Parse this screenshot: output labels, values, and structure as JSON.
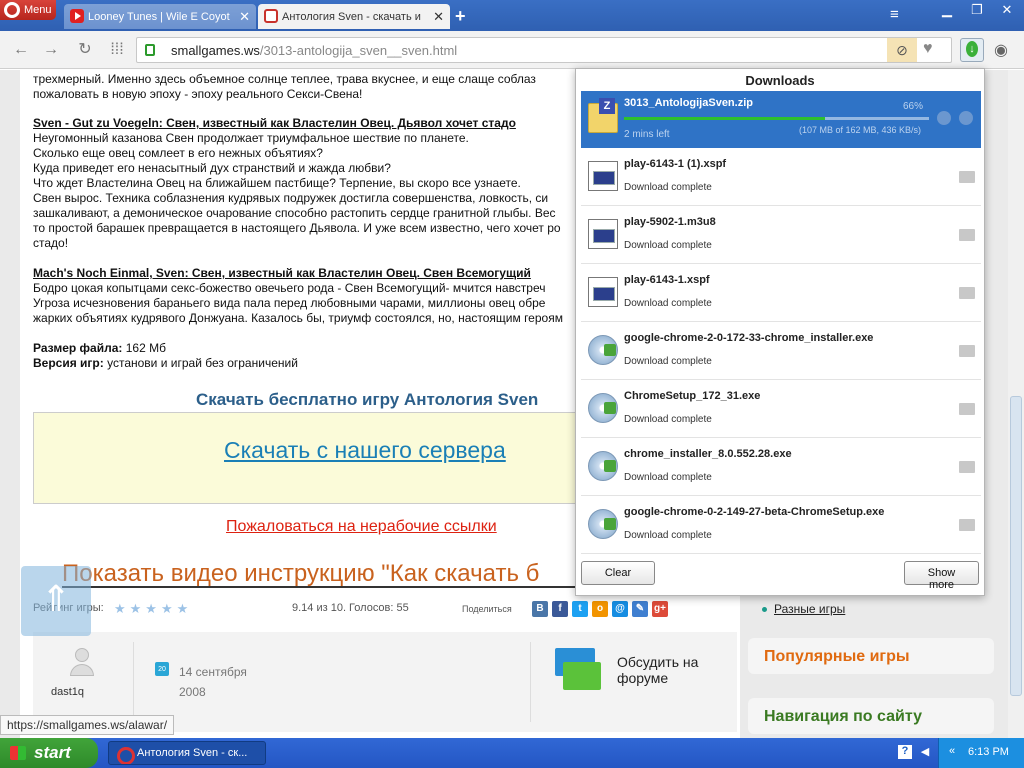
{
  "browser": {
    "menu_label": "Menu",
    "tabs": [
      {
        "title": "Looney Tunes | Wile E Coyot",
        "active": false
      },
      {
        "title": "Антология Sven - скачать и",
        "active": true
      }
    ],
    "address": {
      "host": "smallgames.ws",
      "path": "/3013-antologija_sven__sven.html"
    },
    "status_url": "https://smallgames.ws/alawar/"
  },
  "article": {
    "intro_lines": [
      "трехмерный. Именно здесь объемное солнце теплее, трава вкуснее, и еще слаще соблаз",
      "пожаловать в новую эпоху - эпоху реального Секси-Свена!"
    ],
    "section1": {
      "heading": "Sven - Gut zu Voegeln: Свен, известный как Властелин Овец. Дьявол хочет стадо",
      "lines": [
        "Неугомонный казанова Свен продолжает триумфальное шествие по планете.",
        "Сколько еще овец сомлеет в его нежных объятиях?",
        "Куда приведет его ненасытный дух странствий и жажда любви?",
        "Что ждет Властелина Овец на ближайшем пастбище? Терпение, вы скоро все узнаете.",
        "Свен вырос. Техника соблазнения кудрявых подружек достигла совершенства, ловкость, си",
        "зашкаливают, а демоническое очарование способно растопить сердце гранитной глыбы. Вес",
        "то простой барашек превращается в настоящего Дьявола. И уже всем известно, чего хочет ро",
        "стадо!"
      ]
    },
    "section2": {
      "heading": "Mach's Noch Einmal, Sven: Свен, известный как Властелин Овец. Свен Всемогущий",
      "lines": [
        "Бодро цокая копытцами секс-божество овечьего рода - Свен Всемогущий- мчится навстреч",
        "Угроза исчезновения бараньего вида пала перед любовными чарами, миллионы овец обре",
        "жарких объятиях кудрявого Донжуана. Казалось бы, триумф состоялся, но, настоящим героям"
      ]
    },
    "file_size_label": "Размер файла:",
    "file_size_value": "162 Мб",
    "version_label": "Версия игр:",
    "version_value": "установи и играй без ограничений",
    "download_title": "Скачать бесплатно игру Антология Sven",
    "download_link": "Скачать с нашего сервера",
    "report_link": "Пожаловаться на нерабочие ссылки",
    "video_link": "Показать видео инструкцию \"Как скачать б",
    "rating_label": "Рейтинг игры:",
    "stars": "★★★★★",
    "votes": "9.14 из 10. Голосов: 55",
    "share_label": "Поделиться",
    "share_icons": [
      {
        "glyph": "B",
        "color": "#4a76a8"
      },
      {
        "glyph": "f",
        "color": "#3b5998"
      },
      {
        "glyph": "t",
        "color": "#1da1f2"
      },
      {
        "glyph": "о",
        "color": "#f29400"
      },
      {
        "glyph": "@",
        "color": "#168de2"
      },
      {
        "glyph": "✎",
        "color": "#3f7fd0"
      },
      {
        "glyph": "g+",
        "color": "#dd4b39"
      }
    ],
    "author": "dast1q",
    "calendar_day": "20",
    "date_line1": "14 сентября",
    "date_line2": "2008",
    "forum_line1": "Обсудить на",
    "forum_line2": "форуме"
  },
  "sidebar": {
    "link": "Разные игры",
    "popular": "Популярные игры",
    "navigation": "Навигация по сайту",
    "popular_color": "#e06a10",
    "navigation_color": "#3a7a22"
  },
  "downloads": {
    "title": "Downloads",
    "items": [
      {
        "name": "3013_AntologijaSven.zip",
        "status": "2 mins left",
        "percent": "66%",
        "progress": 0.66,
        "size": "(107 MB of 162 MB, 436 KB/s)",
        "icon": "zip",
        "active": true
      },
      {
        "name": "play-6143-1 (1).xspf",
        "status": "Download complete",
        "icon": "doc"
      },
      {
        "name": "play-5902-1.m3u8",
        "status": "Download complete",
        "icon": "doc"
      },
      {
        "name": "play-6143-1.xspf",
        "status": "Download complete",
        "icon": "doc"
      },
      {
        "name": "google-chrome-2-0-172-33-chrome_installer.exe",
        "status": "Download complete",
        "icon": "cd"
      },
      {
        "name": "ChromeSetup_172_31.exe",
        "status": "Download complete",
        "icon": "cd"
      },
      {
        "name": "chrome_installer_8.0.552.28.exe",
        "status": "Download complete",
        "icon": "cd"
      },
      {
        "name": "google-chrome-0-2-149-27-beta-ChromeSetup.exe",
        "status": "Download complete",
        "icon": "cd"
      }
    ],
    "clear_label": "Clear",
    "show_more_label": "Show more"
  },
  "taskbar": {
    "start_label": "start",
    "task_title": "Антология Sven - ск...",
    "clock": "6:13 PM"
  }
}
